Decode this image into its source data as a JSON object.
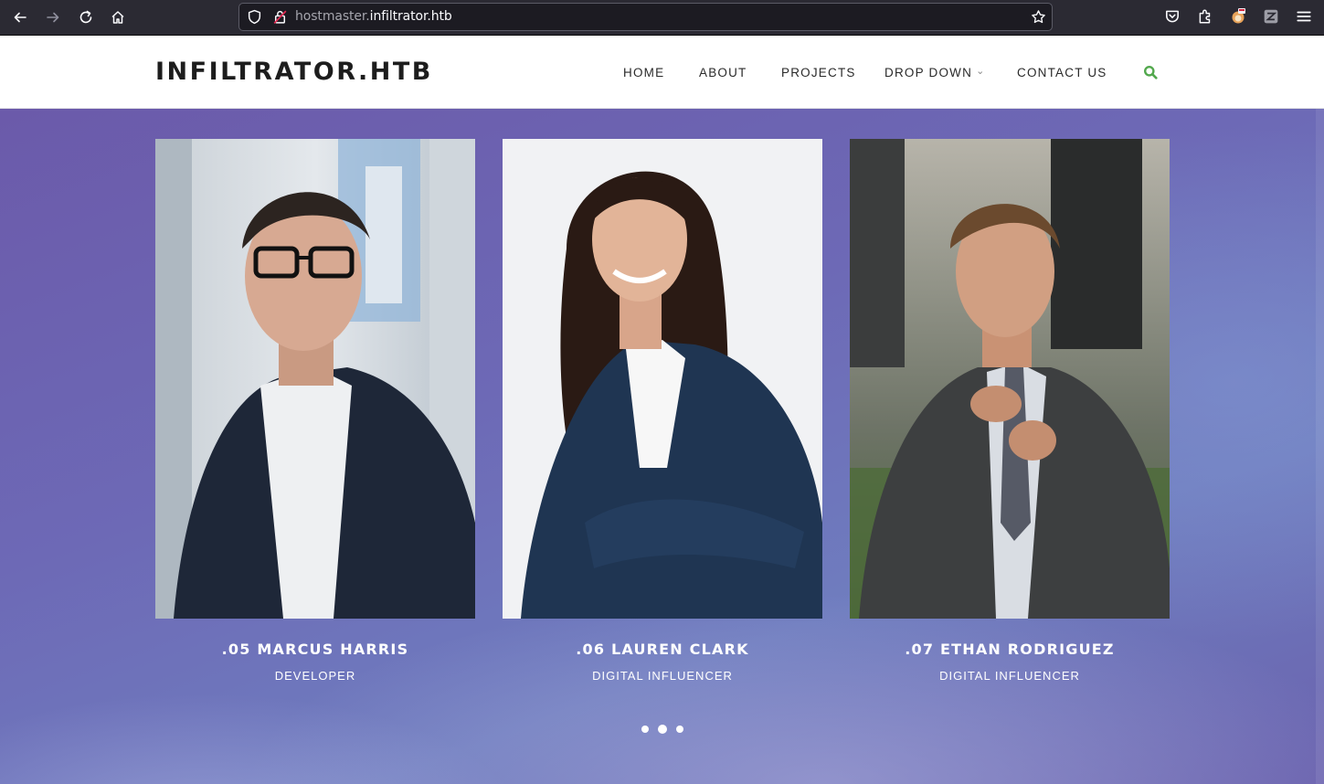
{
  "browser": {
    "url_subdomain": "hostmaster.",
    "url_domain": "infiltrator.htb",
    "icons": [
      "back-icon",
      "forward-icon",
      "reload-icon",
      "home-icon",
      "shield-icon",
      "lock-icon",
      "bookmark-star-icon",
      "pocket-icon",
      "extensions-icon",
      "fox-avatar-icon",
      "zotero-icon",
      "hamburger-menu-icon"
    ]
  },
  "header": {
    "logo": "INFILTRATOR.HTB",
    "nav": [
      {
        "label": "HOME"
      },
      {
        "label": "ABOUT"
      },
      {
        "label": "PROJECTS"
      },
      {
        "label": "DROP DOWN",
        "caret": "⌄"
      },
      {
        "label": "CONTACT US"
      }
    ],
    "search_icon": "search-icon",
    "accent_color": "#52a84d"
  },
  "team": [
    {
      "name": ".05 MARCUS HARRIS",
      "role": "DEVELOPER"
    },
    {
      "name": ".06 LAUREN CLARK",
      "role": "DIGITAL INFLUENCER"
    },
    {
      "name": ".07 ETHAN RODRIGUEZ",
      "role": "DIGITAL INFLUENCER"
    }
  ],
  "carousel": {
    "dot_count": 3,
    "active_index": 1
  },
  "colors": {
    "hero_background": "#6b63b0",
    "text_light": "#ffffff"
  }
}
